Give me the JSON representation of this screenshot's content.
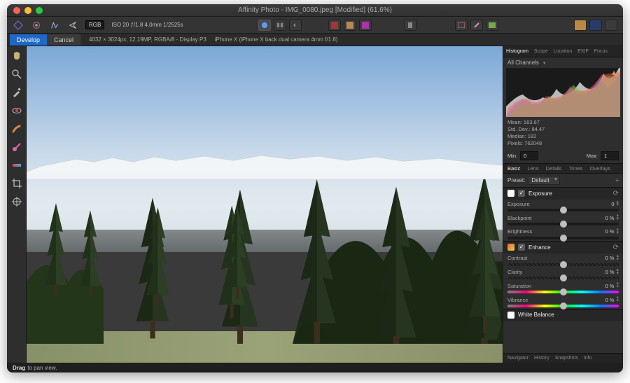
{
  "window": {
    "title": "Affinity Photo - IMG_0080.jpeg [Modified] (61.6%)",
    "traffic": {
      "close": "#ff5f57",
      "min": "#febc2e",
      "max": "#28c840"
    }
  },
  "toolbar": {
    "rgb_pill": "RGB",
    "exif": "ISO 20 ƒ/1.8 4.0mm 1/2525s"
  },
  "infobar": {
    "develop": "Develop",
    "cancel": "Cancel",
    "dims": "4032 × 3024px, 12.19MP, RGBA/8 - Display P3",
    "camera": "iPhone X (iPhone X back dual camera 4mm f/1.8)"
  },
  "right": {
    "tabs": [
      "Histogram",
      "Scope",
      "Location",
      "EXIF",
      "Focus"
    ],
    "channels_label": "All Channels",
    "stats": {
      "mean": "Mean: 163.67",
      "stddev": "Std. Dev.: 84.47",
      "median": "Median: 182",
      "pixels": "Pixels: 762048"
    },
    "min_label": "Min:",
    "min_val": "0",
    "max_label": "Max:",
    "max_val": "1",
    "subtabs": [
      "Basic",
      "Lens",
      "Details",
      "Tones",
      "Overlays"
    ],
    "preset_label": "Preset:",
    "preset_value": "Default",
    "exposure": {
      "title": "Exposure",
      "check": "✓",
      "rows": [
        {
          "label": "Exposure",
          "val": "0",
          "pos": 50
        },
        {
          "label": "Blackpoint",
          "val": "0 %",
          "pos": 50
        },
        {
          "label": "Brightness",
          "val": "0 %",
          "pos": 50
        }
      ]
    },
    "enhance": {
      "title": "Enhance",
      "check": "✓",
      "swatch": "linear-gradient(135deg,#e26b2d,#f0c84a)",
      "rows": [
        {
          "label": "Contrast",
          "val": "0 %",
          "pos": 50,
          "cls": "hatch"
        },
        {
          "label": "Clarity",
          "val": "0 %",
          "pos": 50,
          "cls": "hatch"
        },
        {
          "label": "Saturation",
          "val": "0 %",
          "pos": 50,
          "cls": "sat"
        },
        {
          "label": "Vibrance",
          "val": "0 %",
          "pos": 50,
          "cls": "sat"
        }
      ]
    },
    "whitebalance": {
      "title": "White Balance",
      "swatch": "#ffffff"
    },
    "bottomtabs": [
      "Navigator",
      "History",
      "Snapshots",
      "Info"
    ]
  },
  "status": {
    "hint": "Drag to pan view."
  }
}
